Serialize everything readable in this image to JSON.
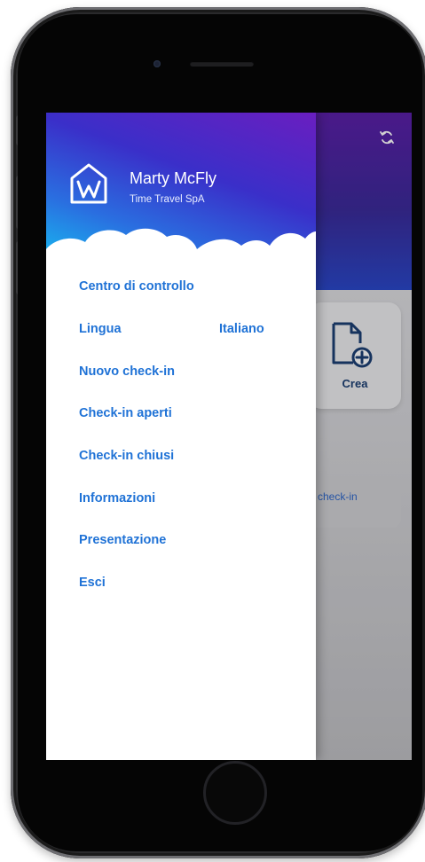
{
  "app": {
    "card_label": "Crea",
    "bar_label": "check-in",
    "icons": {
      "refresh": "refresh-icon",
      "new_document": "new-document-icon"
    }
  },
  "drawer": {
    "user_name": "Marty McFly",
    "company": "Time Travel SpA",
    "logo_icon": "house-w-logo",
    "menu": [
      {
        "label": "Centro di controllo"
      },
      {
        "label": "Lingua",
        "value": "Italiano"
      },
      {
        "label": "Nuovo check-in"
      },
      {
        "label": "Check-in aperti"
      },
      {
        "label": "Check-in chiusi"
      },
      {
        "label": "Informazioni"
      },
      {
        "label": "Presentazione"
      },
      {
        "label": "Esci"
      }
    ]
  },
  "colors": {
    "menu_text": "#1f72d6",
    "header_purple": "#6a1ec0",
    "header_cyan": "#14c4f2",
    "card_label": "#1c3f73"
  }
}
